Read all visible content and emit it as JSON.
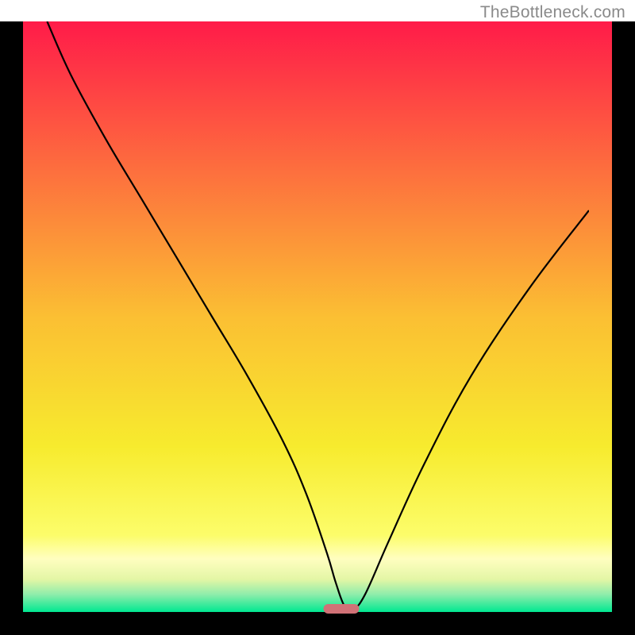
{
  "watermark": "TheBottleneck.com",
  "chart_data": {
    "type": "line",
    "title": "",
    "xlabel": "",
    "ylabel": "",
    "xlim": [
      0,
      100
    ],
    "ylim": [
      0,
      100
    ],
    "grid": false,
    "axes_visible": false,
    "background_gradient": {
      "direction": "vertical_top_to_bottom",
      "stops": [
        {
          "pos": 0.0,
          "color": "#ff1b49"
        },
        {
          "pos": 0.25,
          "color": "#fd6e3e"
        },
        {
          "pos": 0.5,
          "color": "#fbbf33"
        },
        {
          "pos": 0.72,
          "color": "#f7eb2e"
        },
        {
          "pos": 0.87,
          "color": "#fcfd6a"
        },
        {
          "pos": 0.91,
          "color": "#fffec0"
        },
        {
          "pos": 0.945,
          "color": "#e3f6a5"
        },
        {
          "pos": 0.97,
          "color": "#90edab"
        },
        {
          "pos": 1.0,
          "color": "#00e891"
        }
      ]
    },
    "series": [
      {
        "name": "bottleneck-curve",
        "color": "#000000",
        "x": [
          8,
          12,
          18,
          24,
          30,
          36,
          42,
          48,
          52,
          55.5,
          57,
          58.5,
          60,
          62,
          66,
          72,
          80,
          90,
          100
        ],
        "y": [
          100,
          91,
          80,
          70,
          60,
          50,
          40,
          29,
          20,
          10,
          5,
          1,
          0.5,
          3,
          12,
          25,
          40,
          55,
          68
        ]
      }
    ],
    "marker": {
      "x": 58,
      "y": 0.5,
      "color": "#d17277",
      "shape": "capsule"
    }
  }
}
